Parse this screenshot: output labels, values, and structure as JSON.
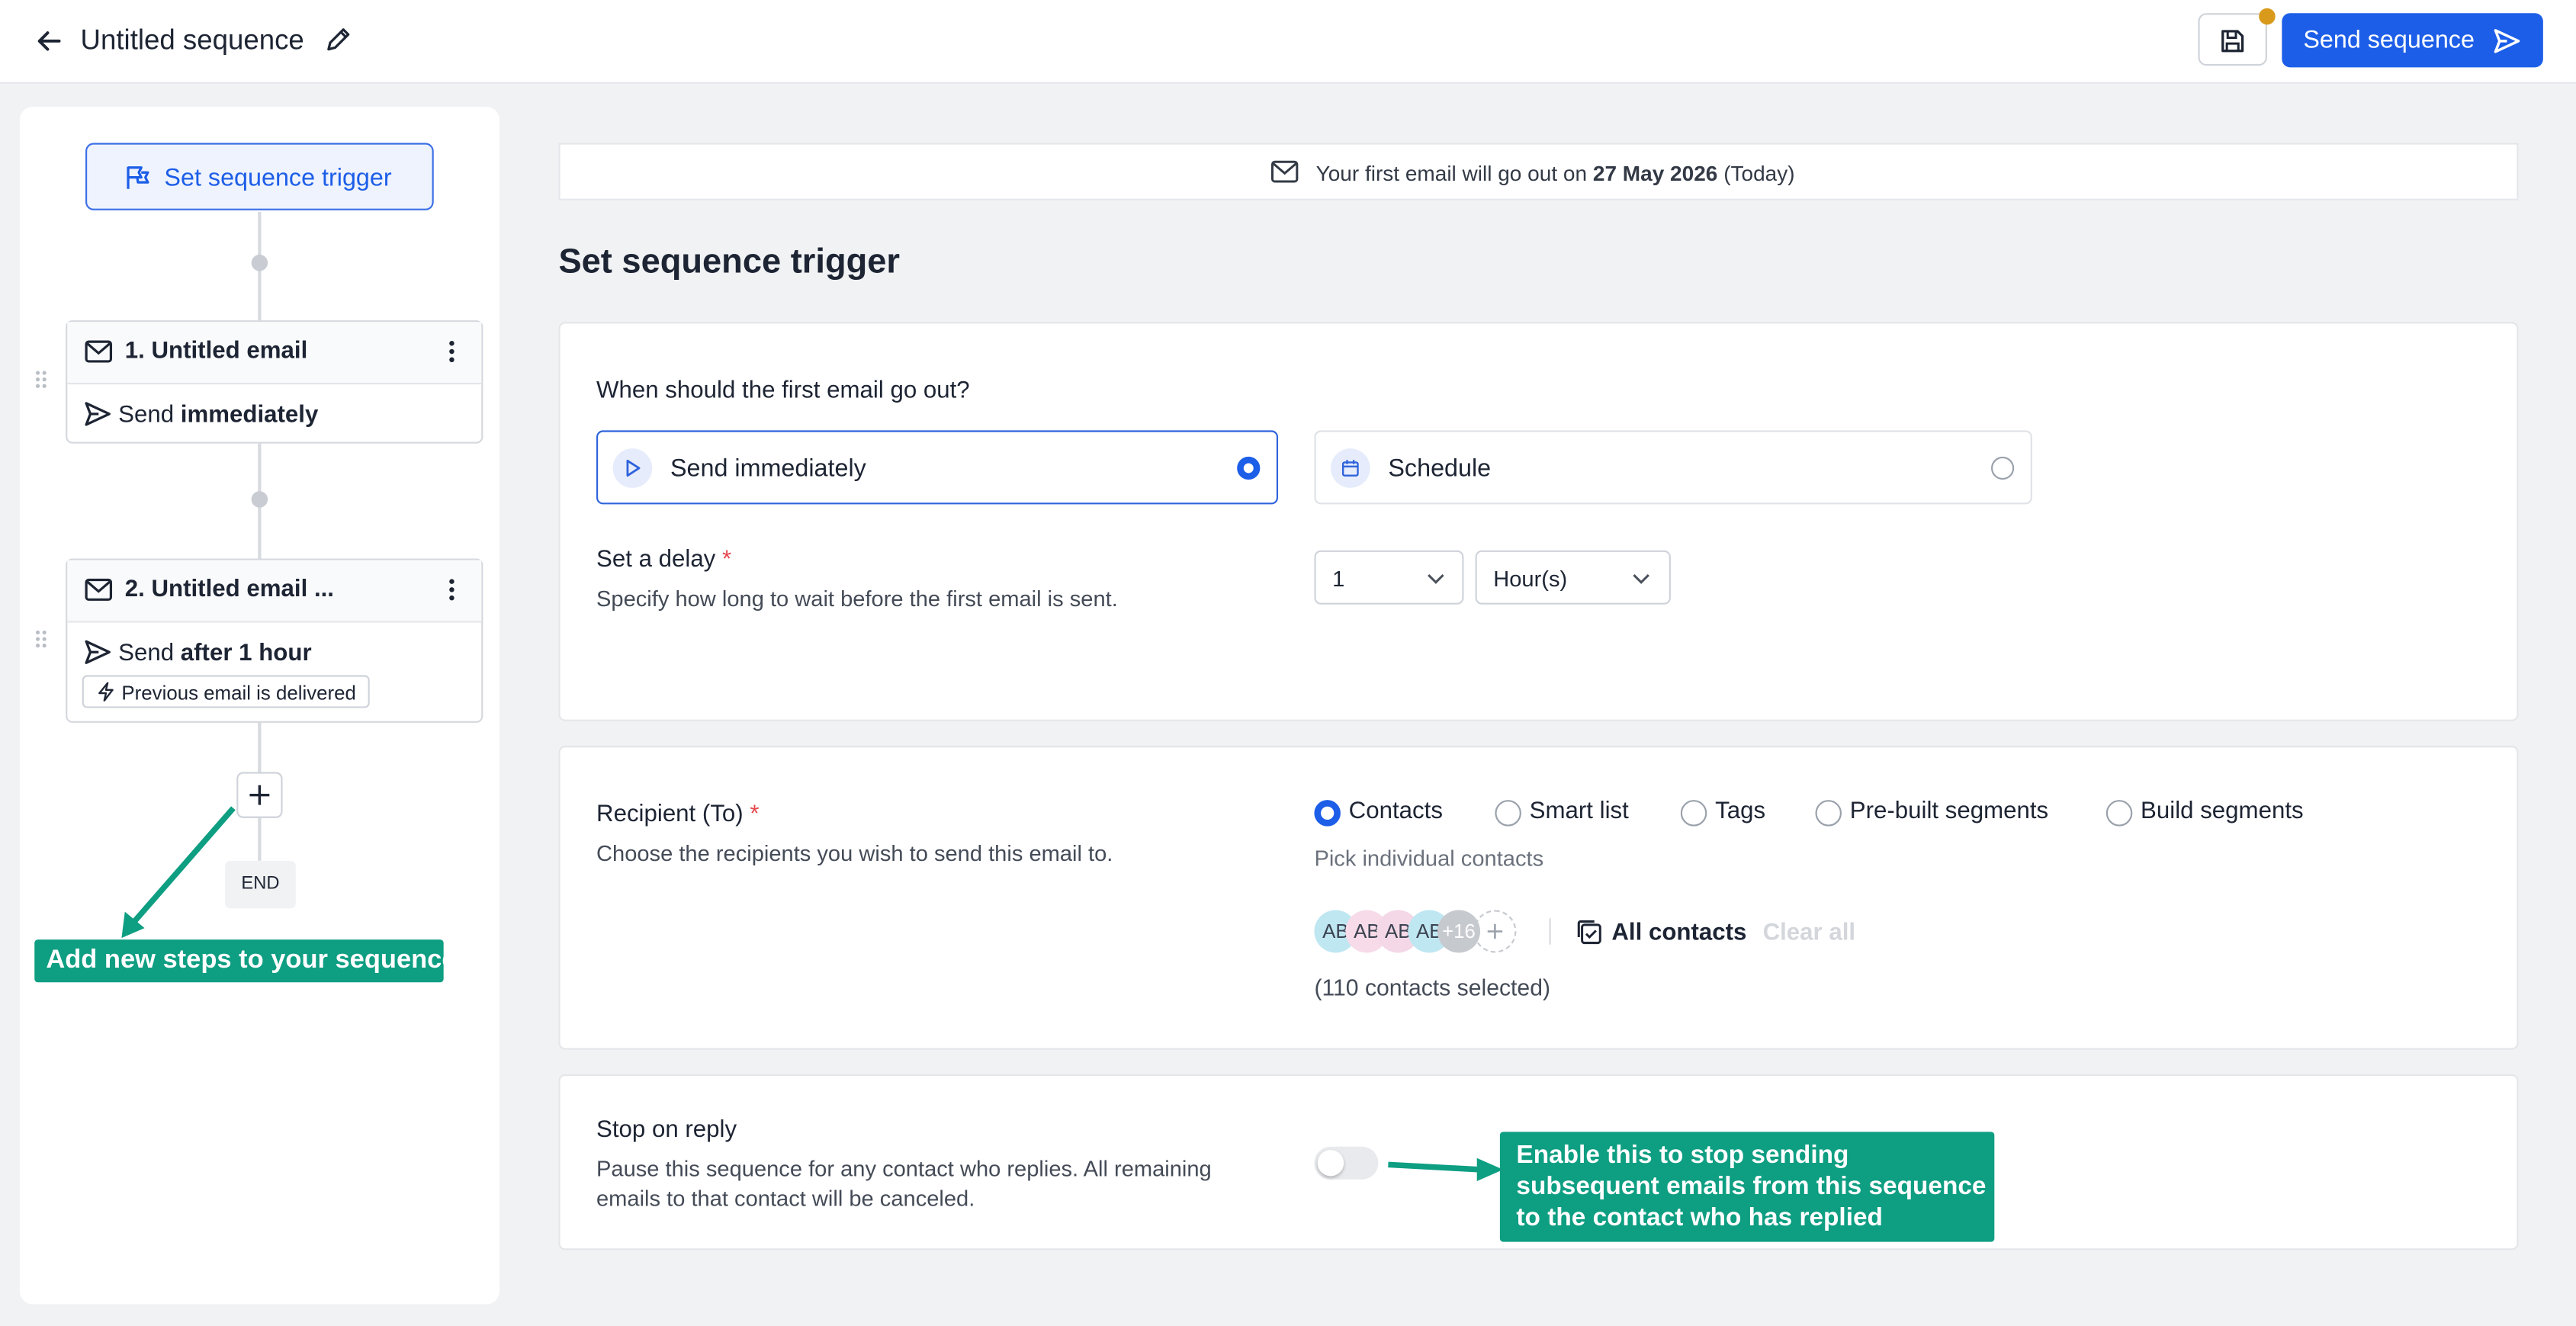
{
  "header": {
    "title": "Untitled sequence",
    "send_label": "Send sequence"
  },
  "sidebar": {
    "trigger_label": "Set sequence trigger",
    "steps": [
      {
        "title": "1. Untitled email",
        "send_prefix": "Send",
        "send_value": "immediately"
      },
      {
        "title": "2. Untitled email ...",
        "send_prefix": "Send",
        "send_value": "after 1 hour",
        "condition": "Previous email is delivered"
      }
    ],
    "end_label": "END",
    "callout": "Add new steps to your sequence"
  },
  "banner": {
    "prefix": "Your first email will go out on",
    "date": "27 May 2026",
    "suffix": "(Today)"
  },
  "page_title": "Set sequence trigger",
  "timing": {
    "question": "When should the first email go out?",
    "options": [
      {
        "label": "Send immediately",
        "selected": true
      },
      {
        "label": "Schedule",
        "selected": false
      }
    ],
    "delay_label": "Set a delay",
    "required_mark": "*",
    "delay_help": "Specify how long to wait before the first email is sent.",
    "delay_value": "1",
    "delay_unit": "Hour(s)"
  },
  "recipients": {
    "label": "Recipient (To)",
    "required_mark": "*",
    "help": "Choose the recipients you wish to send this email to.",
    "types": [
      "Contacts",
      "Smart list",
      "Tags",
      "Pre-built segments",
      "Build segments"
    ],
    "selected_type": "Contacts",
    "pick_hint": "Pick individual contacts",
    "avatars": [
      "AB",
      "AB",
      "AB",
      "AB"
    ],
    "overflow_count": "+16",
    "all_contacts_label": "All contacts",
    "clear_label": "Clear all",
    "selected_count": "(110 contacts selected)"
  },
  "stop_on_reply": {
    "label": "Stop on reply",
    "help_line1": "Pause this sequence for any contact who replies. All remaining",
    "help_line2": "emails to that contact will be canceled.",
    "enabled": false,
    "callout_line1": "Enable this to stop sending",
    "callout_line2": "subsequent emails from this sequence",
    "callout_line3": "to the contact who has replied"
  },
  "colors": {
    "primary": "#1d5ee8",
    "callout": "#0e9e82",
    "save_indicator": "#d99a1b",
    "required": "#e5484d"
  }
}
